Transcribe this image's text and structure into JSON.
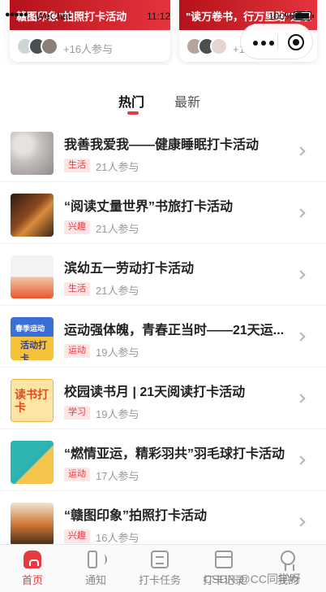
{
  "status_bar": {
    "signal": "●●●●●",
    "carrier": "WeChat",
    "time": "11:12",
    "battery": "100%"
  },
  "top_cards": [
    {
      "title": "赣图印象\"拍照打卡活动",
      "count": "+16人参与"
    },
    {
      "title": "\"读万卷书，行万里路\"之家",
      "count": "+1人参与"
    }
  ],
  "tabs": [
    {
      "label": "热门",
      "active": true
    },
    {
      "label": "最新",
      "active": false
    }
  ],
  "activities": [
    {
      "title": "我善我爱我——健康睡眠打卡活动",
      "tag": "生活",
      "joined": "21人参与",
      "thumb_text": ""
    },
    {
      "title": "“阅读丈量世界”书旅打卡活动",
      "tag": "兴趣",
      "joined": "21人参与",
      "thumb_text": ""
    },
    {
      "title": "滨幼五一劳动打卡活动",
      "tag": "生活",
      "joined": "21人参与",
      "thumb_text": ""
    },
    {
      "title": "运动强体魄，青春正当时——21天运...",
      "tag": "运动",
      "joined": "19人参与",
      "thumb_text": "春季运动",
      "thumb_text2": "活动打卡"
    },
    {
      "title": "校园读书月 | 21天阅读打卡活动",
      "tag": "学习",
      "joined": "19人参与",
      "thumb_text": "读书打卡"
    },
    {
      "title": "“燃情亚运，精彩羽共”羽毛球打卡活动",
      "tag": "运动",
      "joined": "17人参与",
      "thumb_text": ""
    },
    {
      "title": "“赣图印象”拍照打卡活动",
      "tag": "兴趣",
      "joined": "16人参与",
      "thumb_text": ""
    }
  ],
  "bottom_nav": [
    {
      "label": "首页",
      "icon": "home-icon",
      "active": true
    },
    {
      "label": "通知",
      "icon": "speaker-icon",
      "active": false
    },
    {
      "label": "打卡任务",
      "icon": "task-icon",
      "active": false
    },
    {
      "label": "打卡记录",
      "icon": "calendar-icon",
      "active": false
    },
    {
      "label": "我的",
      "icon": "medal-icon",
      "active": false
    }
  ],
  "watermark": "CSDN @CC同学呀",
  "colors": {
    "accent": "#e53a3f",
    "tag_bg": "#fde5e6",
    "muted": "#999999"
  }
}
